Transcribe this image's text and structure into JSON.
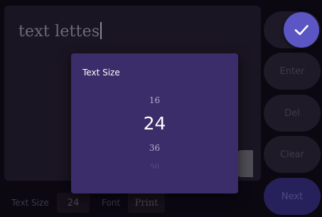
{
  "editor": {
    "text": "text lettes"
  },
  "side_buttons": {
    "enter": "Enter",
    "del": "Del",
    "clear": "Clear",
    "next": "Next"
  },
  "bottom_bar": {
    "text_size_label": "Text Size",
    "text_size_value": "24",
    "font_label": "Font",
    "font_value": "Print"
  },
  "dialog": {
    "title": "Text Size",
    "prev_option": "16",
    "selected_option": "24",
    "next_option": "36",
    "faint_option": "50"
  },
  "colors": {
    "accent": "#5b56c4",
    "dialog_bg": "#3a2d6a",
    "next_button": "#26215a"
  },
  "icons": {
    "confirm": "checkmark-icon"
  }
}
